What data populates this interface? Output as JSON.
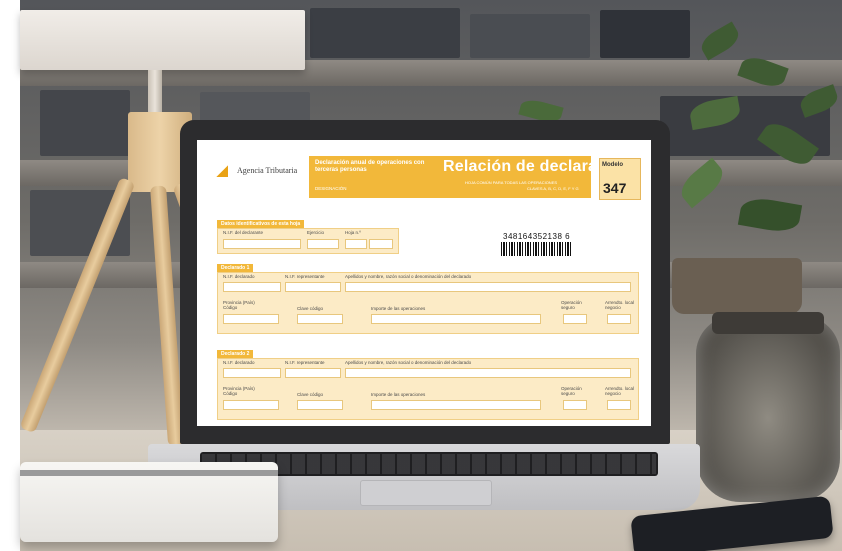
{
  "screen_form": {
    "agency": "Agencia Tributaria",
    "header_subtitle": "Declaración anual de operaciones con terceras personas",
    "header_tag": "DESIGNACIÓN",
    "title": "Relación de declarados",
    "note_line1": "HOJA COMÚN PARA TODAS LAS OPERACIONES",
    "note_line2": "CLAVES A, B, C, D, E, F Y G",
    "modelo_label": "Modelo",
    "modelo_number": "347",
    "section_ident": {
      "tab": "Datos identificativos de esta hoja",
      "nif_label": "N.I.F. del declarante",
      "ejercicio_label": "Ejercicio",
      "hoja_label": "Hoja n.º"
    },
    "barcode_number": "348164352138 6",
    "declarados": [
      {
        "tab": "Declarado 1",
        "nif_declarado": "N.I.F. declarado",
        "nif_representante": "N.I.F. representante",
        "apellidos": "Apellidos y nombre, razón social o denominación del declarado",
        "provincia": "Provincia (País) Código",
        "clave_codigo": "Clave código",
        "importe": "Importe de las operaciones",
        "operacion_seguro": "Operación seguro",
        "arrendamiento": "Arrendto. local negocio"
      },
      {
        "tab": "Declarado 2",
        "nif_declarado": "N.I.F. declarado",
        "nif_representante": "N.I.F. representante",
        "apellidos": "Apellidos y nombre, razón social o denominación del declarado",
        "provincia": "Provincia (País) Código",
        "clave_codigo": "Clave código",
        "importe": "Importe de las operaciones",
        "operacion_seguro": "Operación seguro",
        "arrendamiento": "Arrendto. local negocio"
      }
    ]
  },
  "colors": {
    "form_accent": "#f2b83a",
    "form_section_bg": "#fcebc6",
    "laptop_bezel": "#2c2c2e"
  }
}
